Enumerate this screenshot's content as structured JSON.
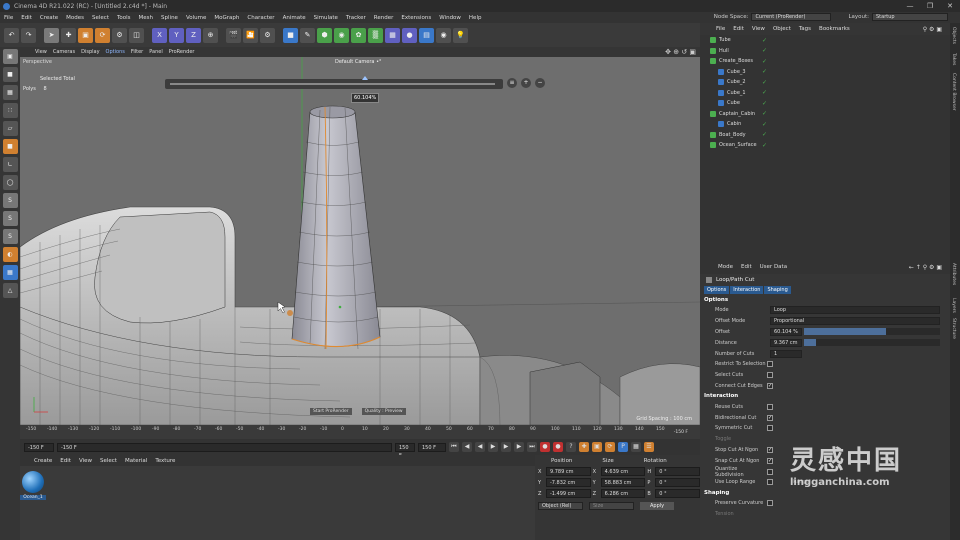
{
  "window": {
    "title": "Cinema 4D R21.022 (RC) - [Untitled 2.c4d *] - Main"
  },
  "menu": [
    "File",
    "Edit",
    "Create",
    "Modes",
    "Select",
    "Tools",
    "Mesh",
    "Spline",
    "Volume",
    "MoGraph",
    "Character",
    "Animate",
    "Simulate",
    "Tracker",
    "Render",
    "Extensions",
    "Window",
    "Help"
  ],
  "node_space": {
    "label": "Node Space:",
    "value": "Current (ProRender)",
    "layout_label": "Layout:",
    "layout_value": "Startup"
  },
  "viewport": {
    "menu": [
      "View",
      "Cameras",
      "Display",
      "Options",
      "Filter",
      "Panel",
      "ProRender"
    ],
    "name": "Perspective",
    "camera": "Default Camera •°",
    "selected_label": "Selected Total",
    "polys_label": "Polys",
    "polys_value": "8",
    "offset_value": "60.104%",
    "offset_fraction": 0.6,
    "start_prorender": "Start ProRender",
    "quality": "Quality : Preview",
    "grid_spacing": "Grid Spacing : 100 cm"
  },
  "timeline": {
    "ticks": [
      "-150",
      "-140",
      "-130",
      "-120",
      "-110",
      "-100",
      "-90",
      "-80",
      "-70",
      "-60",
      "-50",
      "-40",
      "-30",
      "-20",
      "-10",
      "0",
      "10",
      "20",
      "30",
      "40",
      "50",
      "60",
      "70",
      "80",
      "90",
      "100",
      "110",
      "120",
      "130",
      "140",
      "150"
    ],
    "end_label": "-150 F",
    "start_field": "-150 F",
    "min_field": "-150 F",
    "max_field": "150 F",
    "max2_field": "150 F"
  },
  "material": {
    "menu": [
      "Create",
      "Edit",
      "View",
      "Select",
      "Material",
      "Texture"
    ],
    "name": "Ocean_1"
  },
  "coords": {
    "headers": [
      "Position",
      "Size",
      "Rotation"
    ],
    "rows": [
      {
        "axis": "X",
        "pos": "9.789 cm",
        "size_axis": "X",
        "size": "4.639 cm",
        "rot_axis": "H",
        "rot": "0 °"
      },
      {
        "axis": "Y",
        "pos": "-7.832 cm",
        "size_axis": "Y",
        "size": "58.883 cm",
        "rot_axis": "P",
        "rot": "0 °"
      },
      {
        "axis": "Z",
        "pos": "-1.499 cm",
        "size_axis": "Z",
        "size": "6.286 cm",
        "rot_axis": "B",
        "rot": "0 °"
      }
    ],
    "mode": "Object (Rel)",
    "size_mode": "Size",
    "apply": "Apply"
  },
  "objects": {
    "menu": [
      "File",
      "Edit",
      "View",
      "Object",
      "Tags",
      "Bookmarks"
    ],
    "items": [
      {
        "name": "Tube",
        "indent": 0,
        "sel": false
      },
      {
        "name": "Hull",
        "indent": 0,
        "sel": false
      },
      {
        "name": "Create_Boxes",
        "indent": 0,
        "sel": false
      },
      {
        "name": "Cube_3",
        "indent": 1,
        "sel": false
      },
      {
        "name": "Cube_2",
        "indent": 1,
        "sel": false
      },
      {
        "name": "Cube_1",
        "indent": 1,
        "sel": false
      },
      {
        "name": "Cube",
        "indent": 1,
        "sel": false
      },
      {
        "name": "Captain_Cabin",
        "indent": 0,
        "sel": false
      },
      {
        "name": "Cabin",
        "indent": 1,
        "sel": false
      },
      {
        "name": "Boat_Body",
        "indent": 0,
        "sel": false
      },
      {
        "name": "Ocean_Surface",
        "indent": 0,
        "sel": false
      }
    ]
  },
  "attributes": {
    "menu": [
      "Mode",
      "Edit",
      "User Data"
    ],
    "title": "Loop/Path Cut",
    "tabs": [
      "Options",
      "Interaction",
      "Shaping"
    ],
    "options_label": "Options",
    "mode_label": "Mode",
    "mode_value": "Loop",
    "offset_mode_label": "Offset Mode",
    "offset_mode_value": "Proportional",
    "offset_label": "Offset",
    "offset_value": "60.104 %",
    "distance_label": "Distance",
    "distance_value": "9.367 cm",
    "cuts_label": "Number of Cuts",
    "cuts_value": "1",
    "restrict_label": "Restrict To Selection",
    "select_cuts_label": "Select Cuts",
    "connect_label": "Connect Cut Edges",
    "interaction_label": "Interaction",
    "reuse_label": "Reuse Cuts",
    "bidir_label": "Bidirectional Cut",
    "symm_label": "Symmetric Cut",
    "toggle_label": "Toggle",
    "stop_label": "Stop Cut At Ngon",
    "snap_label": "Snap Cut At Ngon",
    "quantize_label": "Quantize Subdivision",
    "use_loop_label": "Use Loop Range",
    "range_label": "Range",
    "shaping_label": "Shaping",
    "preserve_label": "Preserve Curvature",
    "tension_label": "Tension"
  },
  "right_strip": [
    "Objects",
    "Takes",
    "Content Browser",
    "Attributes",
    "Layers",
    "Structure"
  ],
  "watermark": {
    "text": "灵感中国",
    "url": "lingganchina.com"
  }
}
